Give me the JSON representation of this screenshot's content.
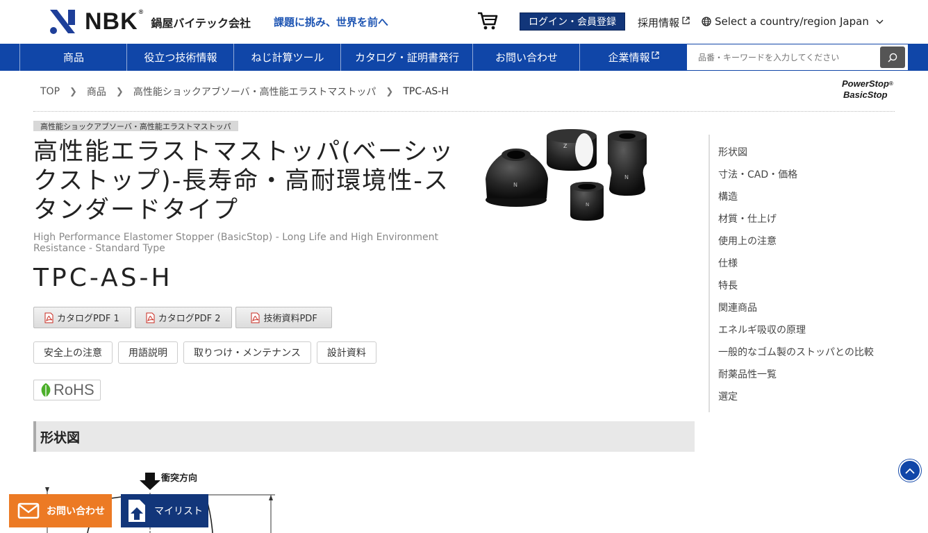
{
  "header": {
    "logo_text": "NBK",
    "logo_reg": "®",
    "company_name": "鍋屋バイテック会社",
    "tagline": "課題に挑み、世界を前へ",
    "login_label": "ログイン・会員登録",
    "recruit_label": "採用情報",
    "country_label": "Select a country/region",
    "country_value": "Japan"
  },
  "nav": {
    "items": [
      {
        "label": "商品"
      },
      {
        "label": "役立つ技術情報"
      },
      {
        "label": "ねじ計算ツール"
      },
      {
        "label": "カタログ・証明書発行"
      },
      {
        "label": "お問い合わせ"
      },
      {
        "label": "企業情報"
      }
    ],
    "search_placeholder": "品番・キーワードを入力してください"
  },
  "breadcrumb": [
    "TOP",
    "商品",
    "高性能ショックアブソーバ・高性能エラストマストッパ",
    "TPC-AS-H"
  ],
  "brand_logo": {
    "line1": "PowerStop",
    "line2": "BasicStop",
    "reg": "®"
  },
  "product": {
    "category_tag": "高性能ショックアブソーバ・高性能エラストマストッパ",
    "title_jp": "高性能エラストマストッパ(ベーシックストップ)-長寿命・高耐環境性-スタンダードタイプ",
    "title_en": "High Performance Elastomer Stopper (BasicStop) - Long Life and High Environment Resistance - Standard Type",
    "model": "TPC-AS-H",
    "pdf_buttons": [
      "カタログPDF 1",
      "カタログPDF 2",
      "技術資料PDF"
    ],
    "doc_buttons": [
      "安全上の注意",
      "用語説明",
      "取りつけ・メンテナンス",
      "設計資料"
    ],
    "rohs": "RoHS"
  },
  "section": {
    "title": "形状図",
    "drawing_label": "衝突方向"
  },
  "side_nav": [
    "形状図",
    "寸法・CAD・価格",
    "構造",
    "材質・仕上げ",
    "使用上の注意",
    "仕様",
    "特長",
    "関連商品",
    "エネルギ吸収の原理",
    "一般的なゴム製のストッパとの比較",
    "耐薬品性一覧",
    "選定"
  ],
  "floating": {
    "contact_label": "お問い合わせ",
    "mylist_label": "マイリスト"
  },
  "colors": {
    "brand_blue": "#1046a8",
    "login_navy": "#12367a",
    "contact_orange": "#ec7a24"
  }
}
